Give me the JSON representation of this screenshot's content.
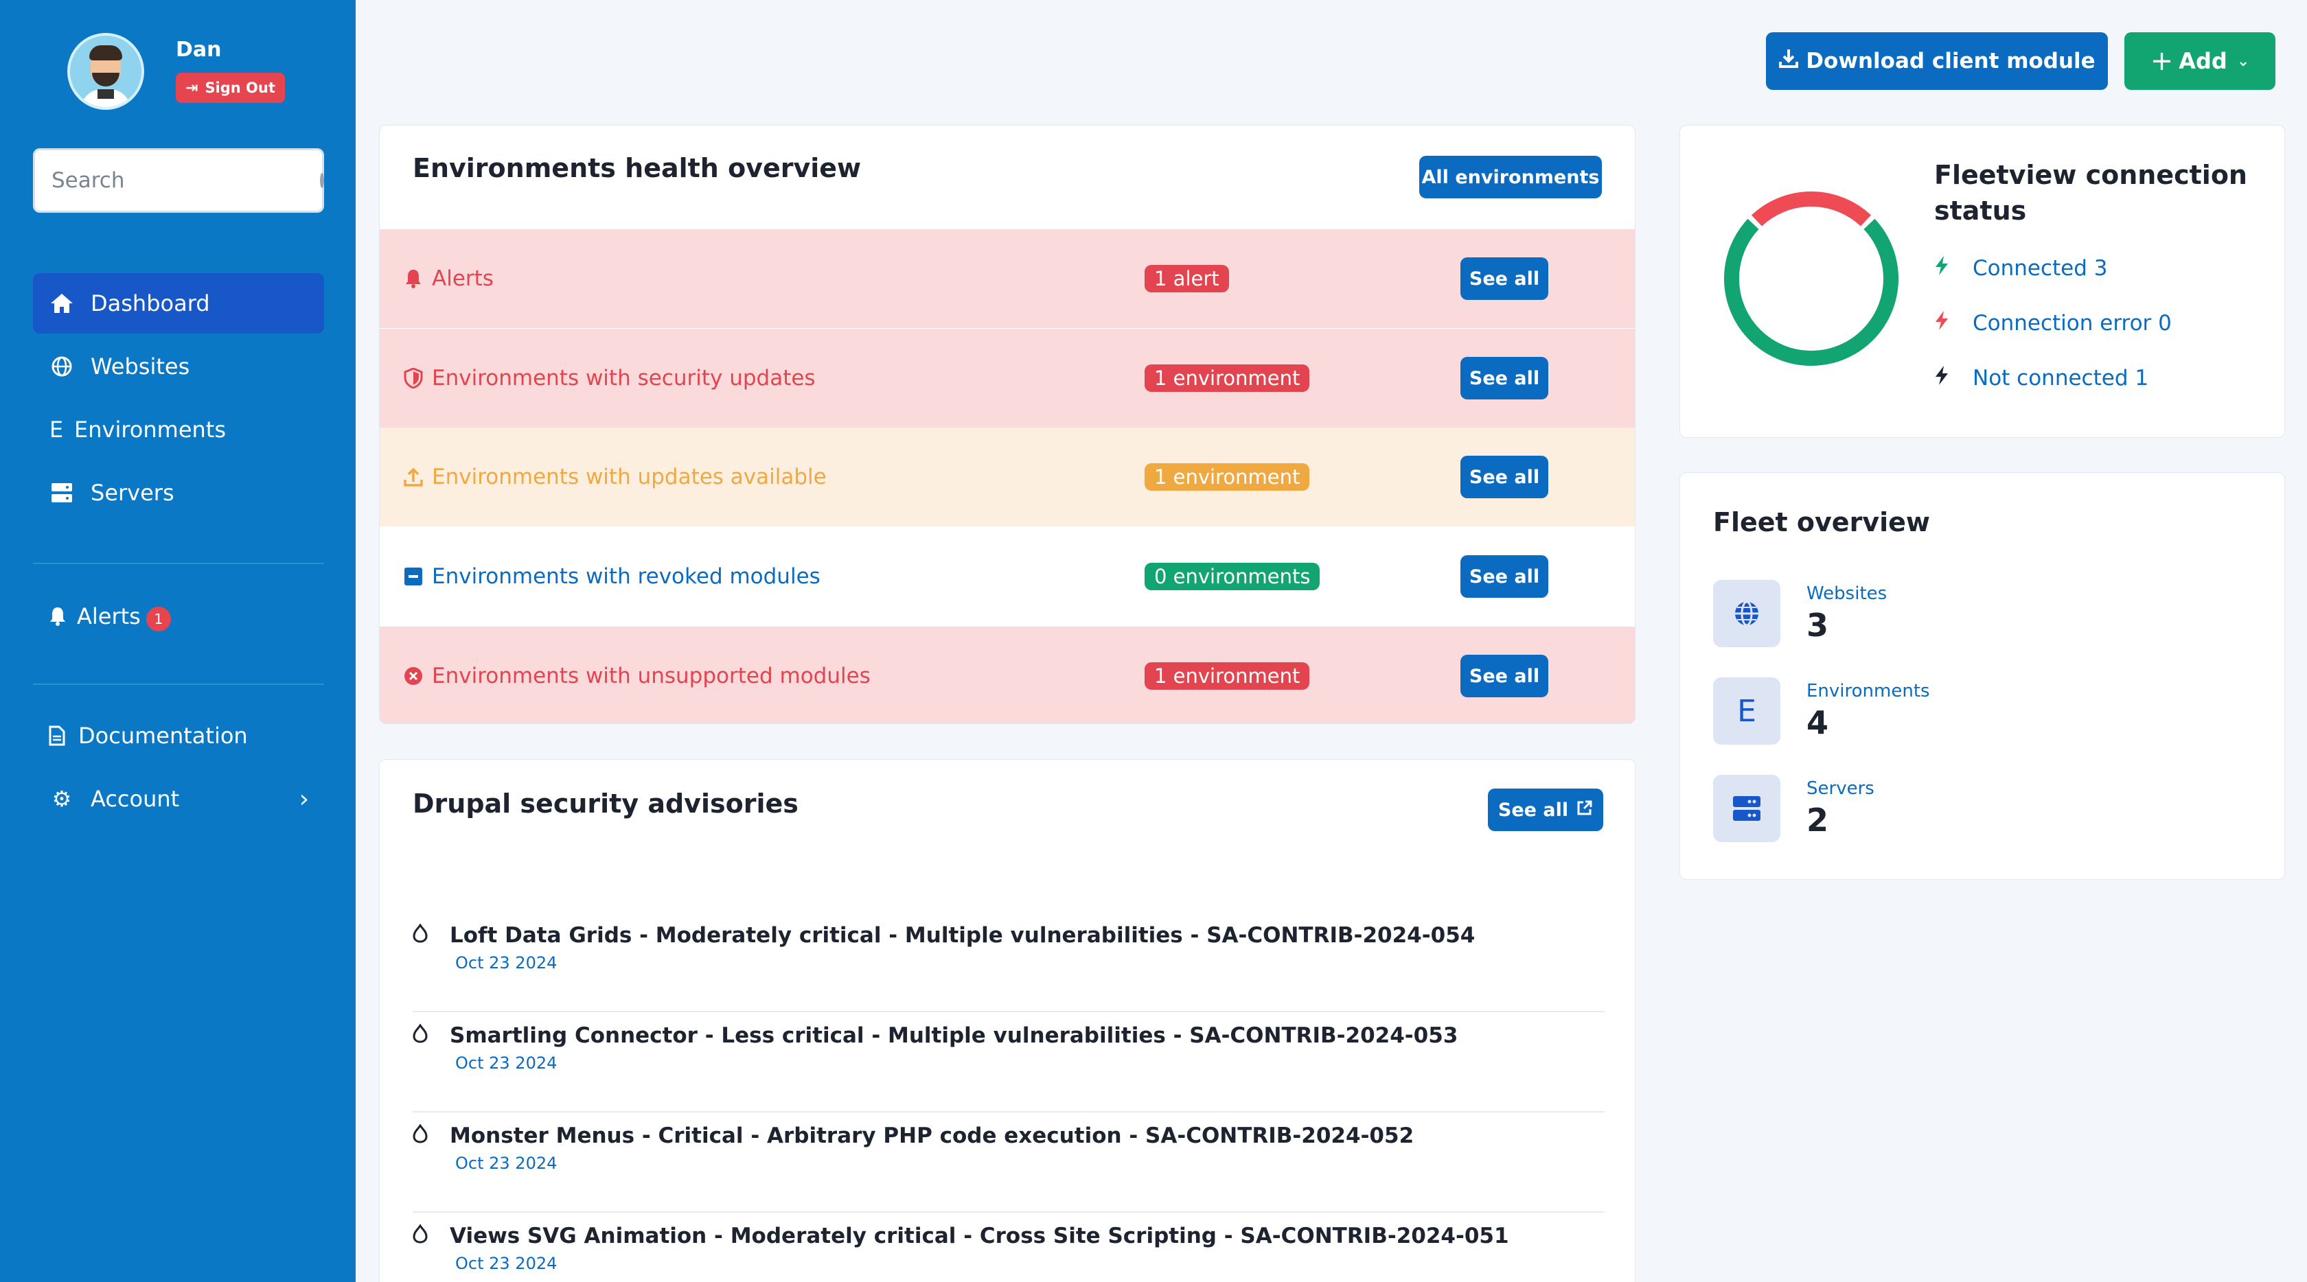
{
  "user": {
    "name": "Dan",
    "sign_out": "Sign Out"
  },
  "search": {
    "placeholder": "Search"
  },
  "nav": {
    "dashboard": "Dashboard",
    "websites": "Websites",
    "environments": "Environments",
    "servers": "Servers",
    "alerts": "Alerts",
    "alerts_count": "1",
    "documentation": "Documentation",
    "account": "Account",
    "environments_glyph": "E"
  },
  "top": {
    "download": "Download client module",
    "add": "Add"
  },
  "health": {
    "title": "Environments health overview",
    "all_button": "All environments",
    "see_all": "See all",
    "rows": [
      {
        "label": "Alerts",
        "pill": "1 alert",
        "icon": "bell-icon"
      },
      {
        "label": "Environments with security updates",
        "pill": "1 environment",
        "icon": "shield-icon"
      },
      {
        "label": "Environments with updates available",
        "pill": "1 environment",
        "icon": "upload-icon"
      },
      {
        "label": "Environments with revoked modules",
        "pill": "0 environments",
        "icon": "minus-square-icon"
      },
      {
        "label": "Environments with unsupported modules",
        "pill": "1 environment",
        "icon": "x-circle-icon"
      }
    ],
    "colors": {
      "red": "#e24550",
      "amber": "#f0a840",
      "green": "#12a471",
      "blue": "#0a6bc0"
    }
  },
  "advisories": {
    "title": "Drupal security advisories",
    "see_all": "See all",
    "items": [
      {
        "title": "Loft Data Grids - Moderately critical - Multiple vulnerabilities - SA-CONTRIB-2024-054",
        "date": "Oct 23 2024"
      },
      {
        "title": "Smartling Connector - Less critical - Multiple vulnerabilities - SA-CONTRIB-2024-053",
        "date": "Oct 23 2024"
      },
      {
        "title": "Monster Menus - Critical - Arbitrary PHP code execution - SA-CONTRIB-2024-052",
        "date": "Oct 23 2024"
      },
      {
        "title": "Views SVG Animation - Moderately critical - Cross Site Scripting - SA-CONTRIB-2024-051",
        "date": "Oct 23 2024"
      }
    ]
  },
  "fleetview": {
    "title": "Fleetview connection status",
    "connected": "Connected 3",
    "error": "Connection error 0",
    "not_connected": "Not connected 1",
    "donut": {
      "connected": 3,
      "error": 0,
      "not_connected": 1,
      "colors": {
        "connected": "#12a471",
        "not_connected": "#ee4b55"
      }
    }
  },
  "fleet": {
    "title": "Fleet overview",
    "websites_label": "Websites",
    "websites_count": "3",
    "environments_label": "Environments",
    "environments_count": "4",
    "servers_label": "Servers",
    "servers_count": "2",
    "environments_glyph": "E"
  }
}
